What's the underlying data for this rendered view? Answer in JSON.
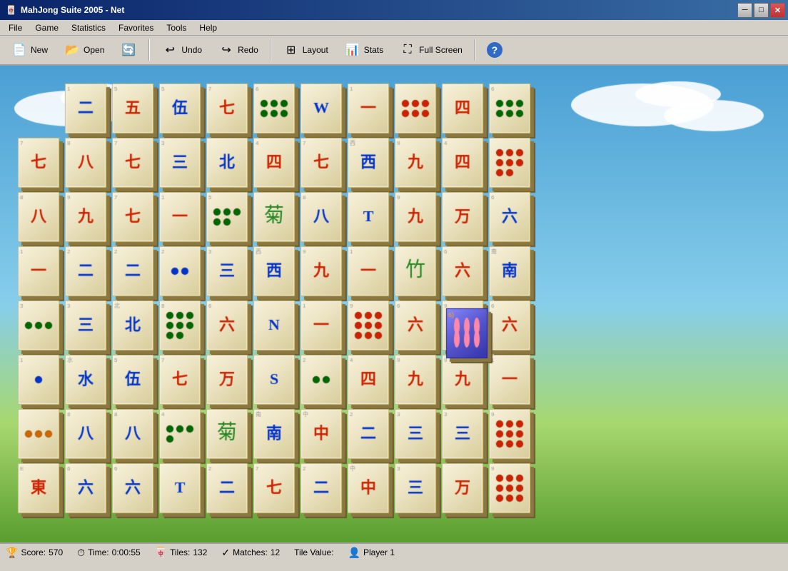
{
  "window": {
    "title": "MahJong Suite 2005 - Net"
  },
  "titlebar": {
    "minimize_label": "─",
    "maximize_label": "□",
    "close_label": "✕"
  },
  "menu": {
    "items": [
      {
        "label": "File",
        "id": "file"
      },
      {
        "label": "Game",
        "id": "game"
      },
      {
        "label": "Statistics",
        "id": "statistics"
      },
      {
        "label": "Favorites",
        "id": "favorites"
      },
      {
        "label": "Tools",
        "id": "tools"
      },
      {
        "label": "Help",
        "id": "help"
      }
    ]
  },
  "toolbar": {
    "buttons": [
      {
        "id": "new",
        "label": "New",
        "icon": "📄"
      },
      {
        "id": "open",
        "label": "Open",
        "icon": "📂"
      },
      {
        "id": "refresh",
        "label": "",
        "icon": "🔄"
      },
      {
        "id": "undo",
        "label": "Undo",
        "icon": "↩"
      },
      {
        "id": "redo",
        "label": "Redo",
        "icon": "↪"
      },
      {
        "id": "layout",
        "label": "Layout",
        "icon": "⊞"
      },
      {
        "id": "stats",
        "label": "Stats",
        "icon": "📊"
      },
      {
        "id": "fullscreen",
        "label": "Full Screen",
        "icon": "⛶"
      },
      {
        "id": "help",
        "label": "",
        "icon": "?"
      }
    ]
  },
  "statusbar": {
    "score_label": "Score:",
    "score_value": "570",
    "time_label": "Time:",
    "time_value": "0:00:55",
    "tiles_label": "Tiles:",
    "tiles_value": "132",
    "matches_label": "Matches:",
    "matches_value": "12",
    "tile_value_label": "Tile Value:",
    "player_label": "Player 1"
  },
  "colors": {
    "sky_top": "#4a9fd4",
    "sky_bottom": "#87ceeb",
    "grass": "#5a9e30",
    "tile_bg": "#f0e8c0",
    "tile_shadow": "#8a7840",
    "tile_border": "#c8b870",
    "selected_tile": "#6060dd"
  }
}
